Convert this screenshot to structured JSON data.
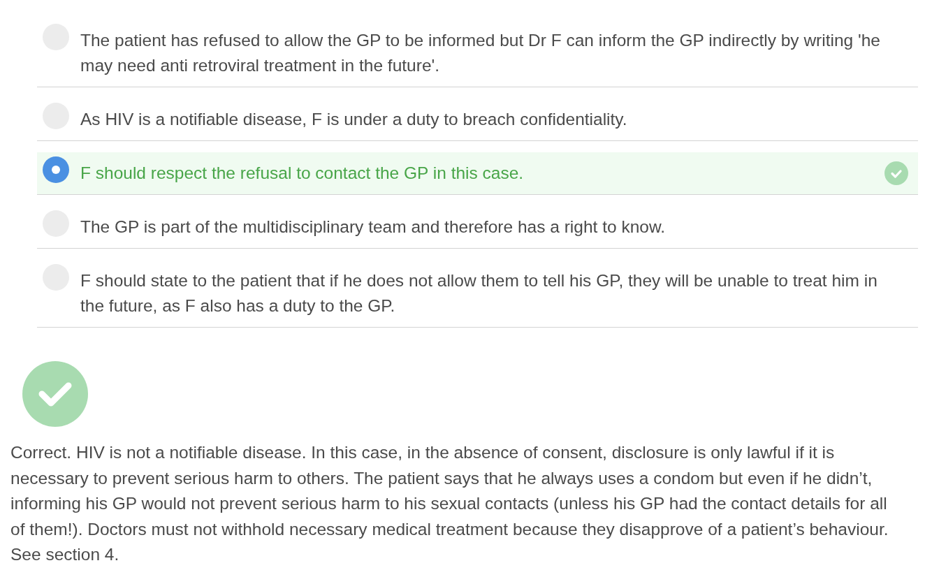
{
  "options": [
    {
      "text": "The patient has refused to allow the GP to be informed but Dr F can inform the GP indirectly by writing 'he may need anti retroviral treatment in the future'.",
      "selected": false,
      "correct": false
    },
    {
      "text": "As HIV is a notifiable disease, F is under a duty to breach confidentiality.",
      "selected": false,
      "correct": false
    },
    {
      "text": "F should respect the refusal to contact the GP in this case.",
      "selected": true,
      "correct": true
    },
    {
      "text": "The GP is part of the multidisciplinary team and therefore has a right to know.",
      "selected": false,
      "correct": false
    },
    {
      "text": "F should state to the patient that if he does not allow them to tell his GP, they will be unable to treat him in the future, as F also has a duty to the GP.",
      "selected": false,
      "correct": false
    }
  ],
  "feedback": {
    "kind": "correct",
    "text": "Correct. HIV is not a notifiable disease. In this case, in the absence of consent, disclosure is only lawful if it is necessary to prevent serious harm to others. The patient says that he always uses a condom but even if he didn’t, informing his GP would not prevent serious harm to his sexual contacts (unless his GP had the contact details for all of them!). Doctors must not withhold necessary medical treatment because they disapprove of a patient’s behaviour. See section 4."
  }
}
